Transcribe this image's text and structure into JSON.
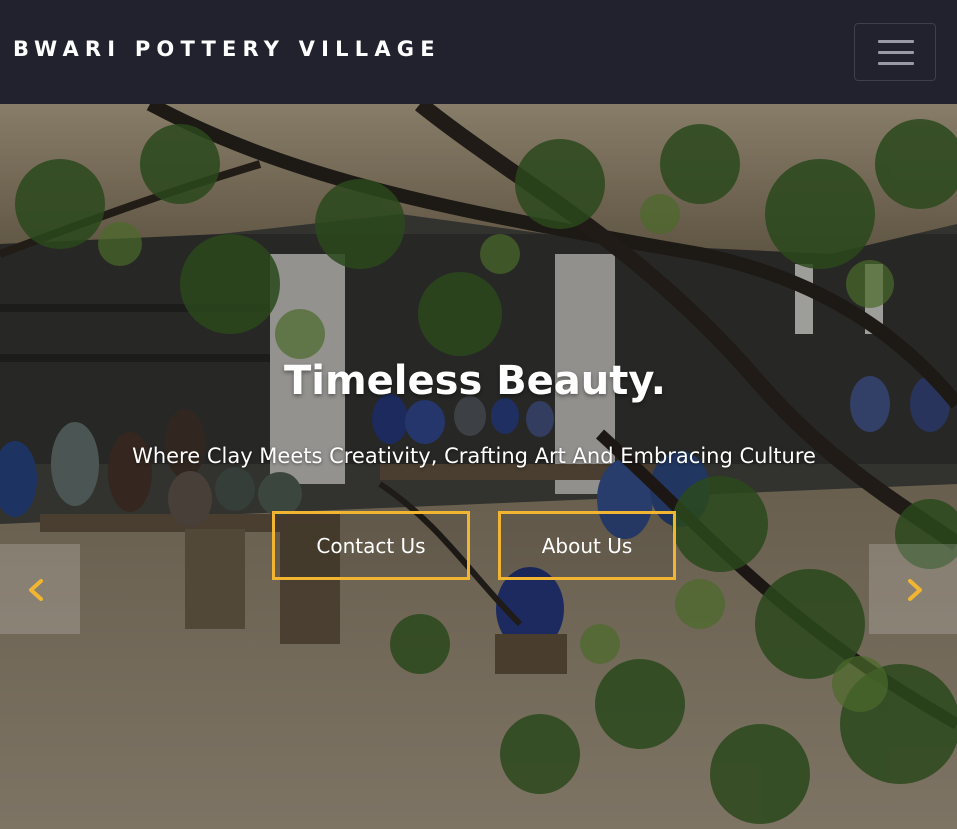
{
  "navbar": {
    "brand": "BWARI POTTERY VILLAGE",
    "menu_icon": "hamburger-menu-icon"
  },
  "hero": {
    "title": "Timeless Beauty.",
    "subtitle": "Where Clay Meets Creativity, Crafting Art And Embracing Culture",
    "buttons": {
      "contact_label": "Contact Us",
      "about_label": "About Us"
    },
    "prev_icon": "chevron-left-icon",
    "next_icon": "chevron-right-icon"
  },
  "colors": {
    "navbar_bg": "#22212e",
    "accent": "#f1b531",
    "text": "#ffffff"
  }
}
